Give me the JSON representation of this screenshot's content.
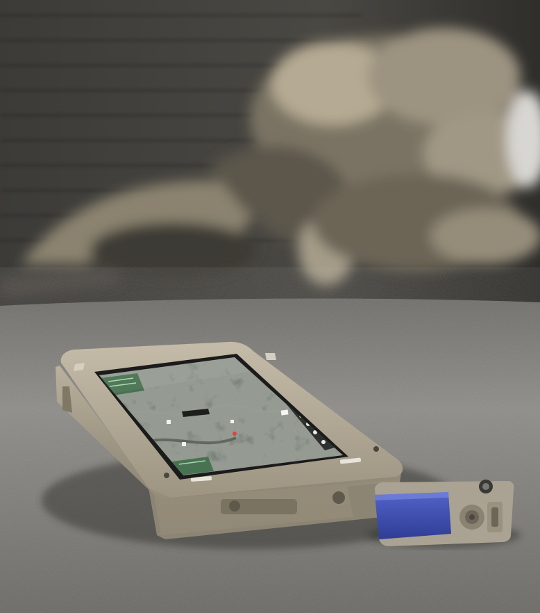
{
  "scene": {
    "description_tags": [
      "rugged-tablet",
      "map-app",
      "usb-dongle",
      "blurred-background",
      "concrete-floor"
    ],
    "colors": {
      "wall_dark": "#3b3a37",
      "wall_mid": "#55534d",
      "floor_light": "#8c8a86",
      "floor_dark": "#5e5d5a",
      "case_tan": "#b3aa98",
      "case_shadow": "#8a826f",
      "screen_map_dark": "#4a5148",
      "screen_map_light": "#7d8476",
      "ui_green": "#3f6e4a",
      "dongle_blue": "#3d4fb3",
      "dongle_body": "#aaa292"
    }
  }
}
